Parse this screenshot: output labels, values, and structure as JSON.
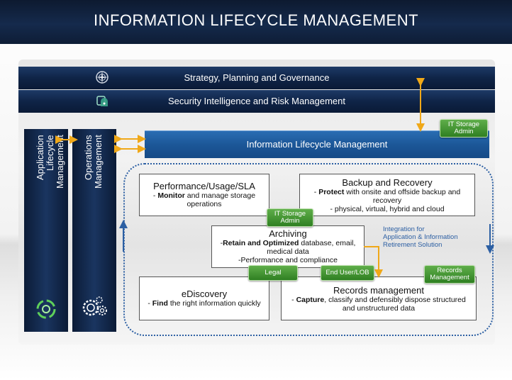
{
  "header": {
    "title": "INFORMATION LIFECYCLE MANAGEMENT"
  },
  "bands": {
    "strategy": "Strategy, Planning and Governance",
    "security": "Security Intelligence and Risk Management"
  },
  "columns": {
    "app_lifecycle": [
      "Application Lifecycle",
      "Management"
    ],
    "operations": [
      "Operations",
      "Management"
    ]
  },
  "ilm_bar": {
    "label": "Information Lifecycle Management"
  },
  "boxes": {
    "performance": {
      "title": "Performance/Usage/SLA",
      "lead": "- ",
      "bold": "Monitor",
      "rest": " and manage storage operations"
    },
    "backup": {
      "title": "Backup and Recovery",
      "lead": "- ",
      "bold": "Protect",
      "rest": " with onsite and offside backup and recovery",
      "line2": "- physical, virtual, hybrid and cloud"
    },
    "archiving": {
      "title": "Archiving",
      "lead": "-",
      "bold": "Retain and Optimized",
      "rest": " database, email, medical data",
      "line2": "-Performance and compliance"
    },
    "ediscovery": {
      "title": "eDiscovery",
      "lead": "- ",
      "bold": "Find",
      "rest": " the right information quickly"
    },
    "records": {
      "title": "Records management",
      "lead": "- ",
      "bold": "Capture",
      "rest": ", classify and defensibly dispose structured and unstructured  data"
    }
  },
  "tags": {
    "it_storage_admin_top": [
      "IT Storage",
      "Admin"
    ],
    "it_storage_admin_mid": [
      "IT Storage",
      "Admin"
    ],
    "legal": "Legal",
    "end_user": "End User/LOB",
    "records_mgmt": [
      "Records",
      "Management"
    ]
  },
  "integration": [
    "Integration for",
    "Application  & Information",
    "Retirement Solution"
  ],
  "icons": [
    "compass-icon",
    "security-icon",
    "lifecycle-icon",
    "gears-icon"
  ],
  "colors": {
    "navy": "#0f2447",
    "blue_bar": "#1c5798",
    "green_tag": "#3a8c2c",
    "arrow_orange": "#f0a818",
    "dotted_blue": "#2c5fa3"
  }
}
